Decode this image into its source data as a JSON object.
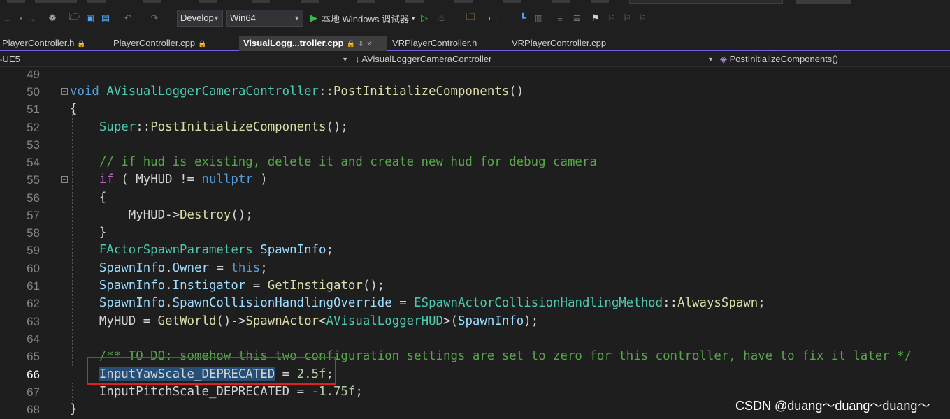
{
  "toolbar": {
    "config_combo": "Develop",
    "platform_combo": "Win64",
    "debugger_label": "本地 Windows 调试器",
    "icons": [
      "back-arrow-icon",
      "forward-arrow-icon",
      "new-item-icon",
      "open-file-icon",
      "save-icon",
      "save-all-icon",
      "undo-icon",
      "redo-icon",
      "play-icon",
      "play-outline-icon",
      "flame-icon",
      "find-in-files-icon",
      "window-layout-icon",
      "breakpoint-icon",
      "step-icon",
      "comment-icon",
      "uncomment-icon",
      "bookmark-icon",
      "prev-bookmark-icon",
      "next-bookmark-icon",
      "clear-bookmarks-icon"
    ]
  },
  "tabs": [
    {
      "label": "PlayerController.h",
      "pinned": true
    },
    {
      "label": "PlayerController.cpp",
      "pinned": true
    },
    {
      "label": "VisualLogg...troller.cpp",
      "pinned": true,
      "active": true
    },
    {
      "label": "VRPlayerController.h",
      "pinned": false
    },
    {
      "label": "VRPlayerController.cpp",
      "pinned": false
    }
  ],
  "navbar": {
    "project": "UE5",
    "scope": "AVisualLoggerCameraController",
    "member": "PostInitializeComponents()"
  },
  "code": {
    "l49": "49",
    "l50": "50",
    "l51": "51",
    "l52": "52",
    "l53": "53",
    "l54": "54",
    "l55": "55",
    "l56": "56",
    "l57": "57",
    "l58": "58",
    "l59": "59",
    "l60": "60",
    "l61": "61",
    "l62": "62",
    "l63": "63",
    "l64": "64",
    "l65": "65",
    "l66": "66",
    "l67": "67",
    "l68": "68",
    "c50a": "void",
    "c50b": " AVisualLoggerCameraController",
    "c50c": "::",
    "c50d": "PostInitializeComponents",
    "c50e": "()",
    "c51": "{",
    "c52a": "    Super",
    "c52b": "::",
    "c52c": "PostInitializeComponents",
    "c52d": "();",
    "c54": "    // if hud is existing, delete it and create new hud for debug camera",
    "c55a": "    if",
    "c55b": " ( ",
    "c55c": "MyHUD",
    "c55d": " != ",
    "c55e": "nullptr",
    "c55f": " )",
    "c56": "    {",
    "c57a": "        MyHUD",
    "c57b": "->",
    "c57c": "Destroy",
    "c57d": "();",
    "c58": "    }",
    "c59a": "    FActorSpawnParameters",
    "c59b": " SpawnInfo",
    "c59c": ";",
    "c60a": "    SpawnInfo",
    "c60b": ".",
    "c60c": "Owner",
    "c60d": " = ",
    "c60e": "this",
    "c60f": ";",
    "c61a": "    SpawnInfo",
    "c61b": ".",
    "c61c": "Instigator",
    "c61d": " = ",
    "c61e": "GetInstigator",
    "c61f": "();",
    "c62a": "    SpawnInfo",
    "c62b": ".",
    "c62c": "SpawnCollisionHandlingOverride",
    "c62d": " = ",
    "c62e": "ESpawnActorCollisionHandlingMethod",
    "c62f": "::",
    "c62g": "AlwaysSpawn",
    "c62h": ";",
    "c63a": "    MyHUD",
    "c63b": " = ",
    "c63c": "GetWorld",
    "c63d": "()->",
    "c63e": "SpawnActor",
    "c63f": "<",
    "c63g": "AVisualLoggerHUD",
    "c63h": ">(",
    "c63i": "SpawnInfo",
    "c63j": ");",
    "c65": "    /** TO DO: somehow this two configuration settings are set to zero for this controller, have to fix it later */",
    "c66a": "    ",
    "c66b": "InputYawScale_DEPRECATED",
    "c66c": " = ",
    "c66d": "2.5f",
    "c66e": ";",
    "c67a": "    InputPitchScale_DEPRECATED",
    "c67b": " = ",
    "c67c": "-1.75f",
    "c67d": ";",
    "c68": "}"
  },
  "watermark": "CSDN @duang～duang～duang～",
  "colors": {
    "accent": "#7160e8",
    "highlight_box": "#e02020",
    "keyword": "#569cd6",
    "type": "#4ec9b0",
    "function": "#dcdcaa",
    "comment": "#57a64a",
    "number": "#b5cea8"
  }
}
